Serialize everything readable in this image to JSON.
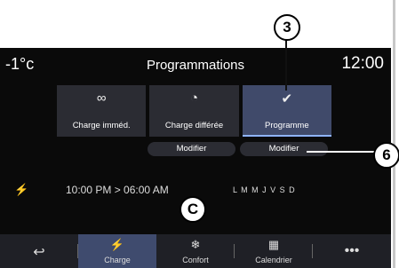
{
  "topbar": {
    "temp": "-1°c",
    "title": "Programmations",
    "clock": "12:00"
  },
  "modes": [
    {
      "icon": "∞",
      "label": "Charge imméd."
    },
    {
      "icon": "◔",
      "label": "Charge différée"
    },
    {
      "icon": "✔",
      "label": "Programme"
    }
  ],
  "modifiers": [
    "Modifier",
    "Modifier"
  ],
  "schedule": {
    "time": "10:00 PM > 06:00 AM",
    "days": "L M M J V S D"
  },
  "nav": [
    {
      "icon": "↩",
      "label": ""
    },
    {
      "icon": "⚡",
      "label": "Charge"
    },
    {
      "icon": "❄",
      "label": "Confort"
    },
    {
      "icon": "▦",
      "label": "Calendrier"
    },
    {
      "icon": "•••",
      "label": ""
    }
  ],
  "callouts": {
    "a": "3",
    "b": "6",
    "c": "C"
  }
}
